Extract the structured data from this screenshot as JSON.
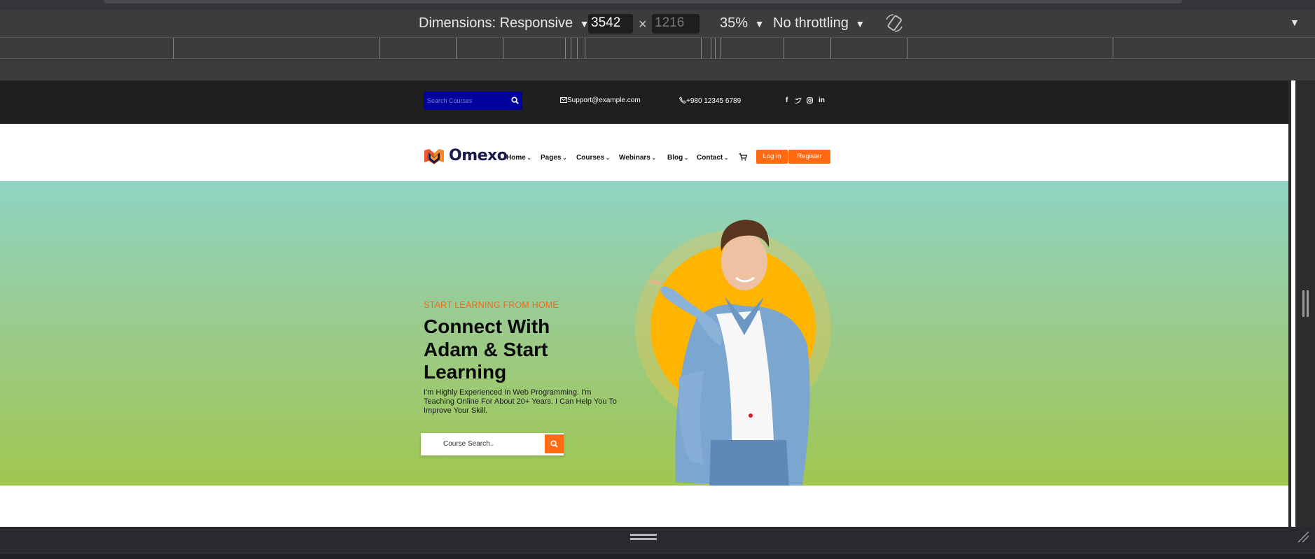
{
  "devtools": {
    "dimensions_label": "Dimensions: Responsive",
    "width_value": "3542",
    "times": "×",
    "height_placeholder": "1216",
    "zoom": "35%",
    "throttling": "No throttling"
  },
  "site": {
    "topbar": {
      "search_placeholder": "Search Courses",
      "email": "Support@example.com",
      "phone": "+980 12345 6789"
    },
    "brand": "Omexo",
    "nav": [
      {
        "label": "Home"
      },
      {
        "label": "Pages"
      },
      {
        "label": "Courses"
      },
      {
        "label": "Webinars"
      },
      {
        "label": "Blog"
      },
      {
        "label": "Contact"
      }
    ],
    "login_label": "Log in",
    "register_label": "Register",
    "hero": {
      "eyebrow": "START LEARNING FROM HOME",
      "title": "Connect With Adam & Start Learning",
      "description": "I'm Highly Experienced In Web Programming. I'm Teaching Online For About 20+ Years. I Can Help You To Improve Your Skill.",
      "search_placeholder": "Course Search.."
    }
  },
  "colors": {
    "accent": "#ff6a13",
    "brand_navy": "#1b1a4e",
    "topbar_bg": "#1f1f1f",
    "search_bg": "#00009c",
    "hero_top": "#8ed5c3",
    "hero_bottom": "#a0c74f",
    "sun": "#ffb400"
  },
  "icons": [
    "search-icon",
    "mail-icon",
    "phone-icon",
    "facebook-icon",
    "twitter-icon",
    "instagram-icon",
    "linkedin-icon",
    "cart-icon",
    "chevron-down-icon",
    "rotate-icon",
    "menu-icon",
    "resize-grip-icon"
  ]
}
